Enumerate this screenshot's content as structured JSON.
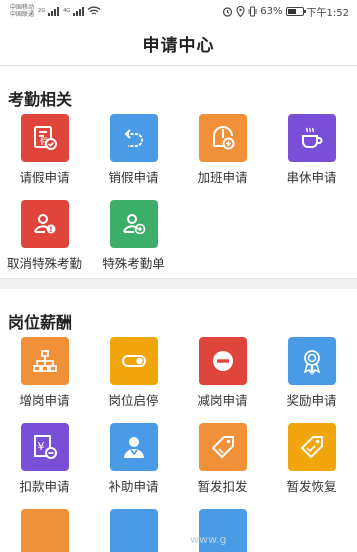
{
  "status_bar": {
    "carrier_1": "中国移动",
    "carrier_2": "中国联通",
    "network_1": "2G",
    "network_2": "4G",
    "battery_percent": "63%",
    "battery_level": 0.63,
    "time": "下午1:52"
  },
  "header": {
    "title": "申请中心"
  },
  "sections": [
    {
      "title": "考勤相关",
      "items": [
        {
          "label": "请假申请",
          "color": "#e0453b",
          "icon": "leave-icon"
        },
        {
          "label": "销假申请",
          "color": "#4a9be6",
          "icon": "undo-icon"
        },
        {
          "label": "加班申请",
          "color": "#f0913a",
          "icon": "clock-add-icon"
        },
        {
          "label": "串休申请",
          "color": "#7a4fd8",
          "icon": "coffee-icon"
        },
        {
          "label": "取消特殊考勤",
          "color": "#e0453b",
          "icon": "user-cancel-icon"
        },
        {
          "label": "特殊考勤单",
          "color": "#3cae6a",
          "icon": "user-add-icon"
        }
      ]
    },
    {
      "title": "岗位薪酬",
      "items": [
        {
          "label": "增岗申请",
          "color": "#f0913a",
          "icon": "org-chart-icon"
        },
        {
          "label": "岗位启停",
          "color": "#f2a60d",
          "icon": "toggle-icon"
        },
        {
          "label": "减岗申请",
          "color": "#e0453b",
          "icon": "minus-circle-icon"
        },
        {
          "label": "奖励申请",
          "color": "#4a9be6",
          "icon": "award-icon"
        },
        {
          "label": "扣款申请",
          "color": "#7a4fd8",
          "icon": "deduct-icon"
        },
        {
          "label": "补助申请",
          "color": "#4a9be6",
          "icon": "subsidy-icon"
        },
        {
          "label": "暂发扣发",
          "color": "#f0913a",
          "icon": "tag-icon"
        },
        {
          "label": "暂发恢复",
          "color": "#f2a60d",
          "icon": "tag-restore-icon"
        }
      ]
    }
  ],
  "watermark": "www.g"
}
